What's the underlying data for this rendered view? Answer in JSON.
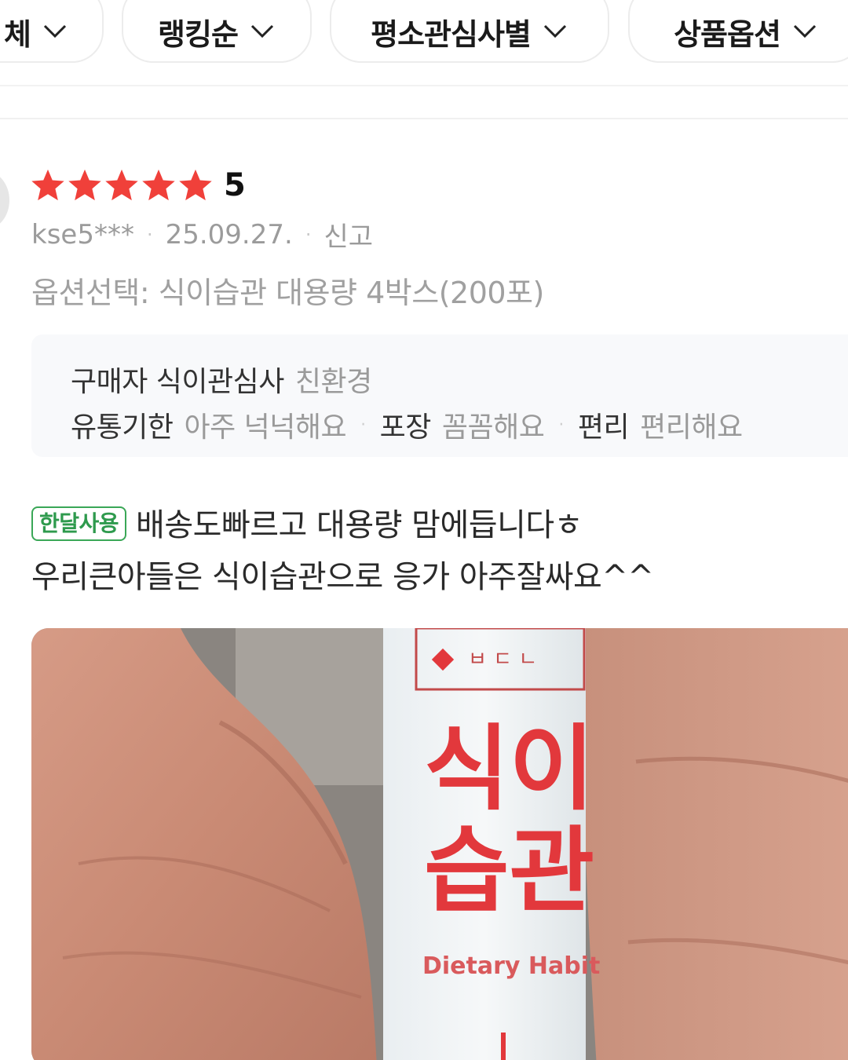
{
  "filters": [
    {
      "label": "체"
    },
    {
      "label": "랭킹순"
    },
    {
      "label": "평소관심사별"
    },
    {
      "label": "상품옵션"
    }
  ],
  "review": {
    "rating": 5,
    "rating_label": "5",
    "user": "kse5***",
    "date": "25.09.27.",
    "report": "신고",
    "option": "옵션선택: 식이습관 대용량 4박스(200포)",
    "survey": {
      "buyer_key": "구매자 식이관심사",
      "buyer_value": "친환경",
      "items": [
        {
          "key": "유통기한",
          "value": "아주 넉넉해요"
        },
        {
          "key": "포장",
          "value": "꼼꼼해요"
        },
        {
          "key": "편리",
          "value": "편리해요"
        }
      ]
    },
    "badge": "한달사용",
    "text_line1": "배송도빠르고 대용량 맘에듭니다ㅎ",
    "text_line2": "우리큰아들은 식이습관으로 응가 아주잘싸요^^"
  },
  "photo": {
    "product_line1": "식이",
    "product_line2": "습관",
    "product_en": "Dietary Habit",
    "product_top": "ㅂ ㄷ ㄴ"
  },
  "colors": {
    "star": "#f0403a",
    "badge": "#3aa757",
    "product_red": "#e2383c"
  }
}
